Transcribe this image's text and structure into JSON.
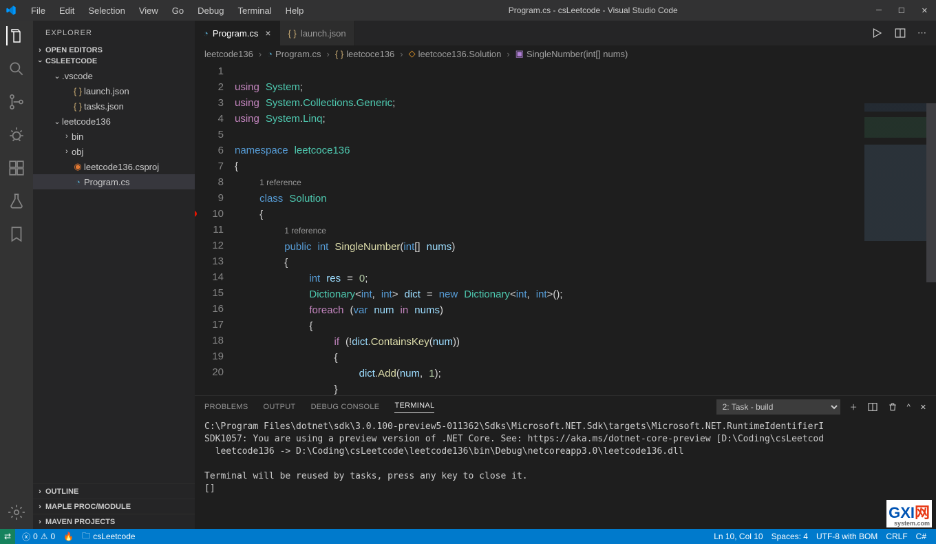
{
  "window": {
    "title": "Program.cs - csLeetcode - Visual Studio Code"
  },
  "menu": [
    "File",
    "Edit",
    "Selection",
    "View",
    "Go",
    "Debug",
    "Terminal",
    "Help"
  ],
  "activity": [
    "files",
    "search",
    "scm",
    "debug",
    "extensions",
    "test",
    "symbol"
  ],
  "sidebar": {
    "header": "EXPLORER",
    "sections": {
      "openEditors": "OPEN EDITORS",
      "project": "CSLEETCODE",
      "outline": "OUTLINE",
      "maple": "MAPLE PROC/MODULE",
      "maven": "MAVEN PROJECTS"
    },
    "tree": [
      {
        "depth": 1,
        "chev": "down",
        "label": ".vscode"
      },
      {
        "depth": 2,
        "icon": "braces",
        "label": "launch.json"
      },
      {
        "depth": 2,
        "icon": "braces",
        "label": "tasks.json"
      },
      {
        "depth": 1,
        "chev": "down",
        "label": "leetcode136"
      },
      {
        "depth": 2,
        "chev": "right",
        "label": "bin"
      },
      {
        "depth": 2,
        "chev": "right",
        "label": "obj"
      },
      {
        "depth": 2,
        "icon": "rss",
        "label": "leetcode136.csproj"
      },
      {
        "depth": 2,
        "icon": "cs",
        "label": "Program.cs",
        "selected": true
      }
    ]
  },
  "tabs": [
    {
      "icon": "cs",
      "label": "Program.cs",
      "active": true,
      "close": true
    },
    {
      "icon": "braces",
      "label": "launch.json",
      "active": false
    }
  ],
  "breadcrumb": [
    {
      "label": "leetcode136"
    },
    {
      "icon": "cs",
      "label": "Program.cs"
    },
    {
      "icon": "braces",
      "label": "leetcoce136"
    },
    {
      "icon": "class",
      "label": "leetcoce136.Solution"
    },
    {
      "icon": "method",
      "label": "SingleNumber(int[] nums)"
    }
  ],
  "codelens": {
    "ref1": "1 reference",
    "ref2": "1 reference"
  },
  "code_lines": [
    1,
    2,
    3,
    4,
    5,
    6,
    7,
    8,
    9,
    10,
    11,
    12,
    13,
    14,
    15,
    16,
    17,
    18,
    19,
    20
  ],
  "breakpoint_line": 10,
  "panel": {
    "tabs": [
      "PROBLEMS",
      "OUTPUT",
      "DEBUG CONSOLE",
      "TERMINAL"
    ],
    "active": 3,
    "dropdown": "2: Task - build",
    "body": "C:\\Program Files\\dotnet\\sdk\\3.0.100-preview5-011362\\Sdks\\Microsoft.NET.Sdk\\targets\\Microsoft.NET.RuntimeIdentifierI\nSDK1057: You are using a preview version of .NET Core. See: https://aka.ms/dotnet-core-preview [D:\\Coding\\csLeetcod\n  leetcode136 -> D:\\Coding\\csLeetcode\\leetcode136\\bin\\Debug\\netcoreapp3.0\\leetcode136.dll\n\nTerminal will be reused by tasks, press any key to close it.\n[]"
  },
  "status": {
    "remote_icon": "⇄",
    "errors": "0",
    "warnings": "0",
    "sync_icon": "⟳",
    "folder": "csLeetcode",
    "ln_col": "Ln 10, Col 10",
    "spaces": "Spaces: 4",
    "encoding": "UTF-8 with BOM",
    "eol": "CRLF",
    "lang": "C#"
  },
  "watermark": {
    "big": "GXI",
    "domain": "网",
    "sub": "system.com"
  }
}
